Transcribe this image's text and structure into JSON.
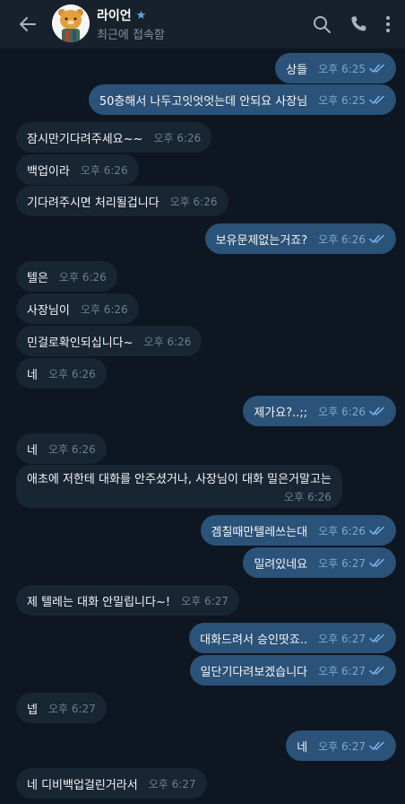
{
  "header": {
    "title": "라이언",
    "status": "최근에 접속함",
    "accent": "#5ea8f0",
    "icons": [
      "back-arrow-icon",
      "verified-star-icon",
      "search-icon",
      "phone-icon",
      "more-vertical-icon"
    ]
  },
  "messages": [
    {
      "dir": "out",
      "text": "상들",
      "time": "오후 6:25"
    },
    {
      "dir": "out",
      "text": "50층해서 나두고잇엇엇는데 안되요 사장님",
      "time": "오후 6:25"
    },
    {
      "dir": "in",
      "text": "잠시만기다려주세요~~",
      "time": "오후 6:26"
    },
    {
      "dir": "in",
      "text": "백업이라",
      "time": "오후 6:26"
    },
    {
      "dir": "in",
      "text": "기다려주시면 처리될겁니다",
      "time": "오후 6:26"
    },
    {
      "dir": "out",
      "text": "보유문제없는거죠?",
      "time": "오후 6:26"
    },
    {
      "dir": "in",
      "text": "텔은",
      "time": "오후 6:26"
    },
    {
      "dir": "in",
      "text": "사장님이",
      "time": "오후 6:26"
    },
    {
      "dir": "in",
      "text": "민걸로확인되십니다~",
      "time": "오후 6:26"
    },
    {
      "dir": "in",
      "text": "네",
      "time": "오후 6:26"
    },
    {
      "dir": "out",
      "text": "제가요?..;;",
      "time": "오후 6:26"
    },
    {
      "dir": "in",
      "text": "네",
      "time": "오후 6:26"
    },
    {
      "dir": "in",
      "text": "애초에 저한테 대화를 안주셨거나, 사장님이 대화 밀은거말고는",
      "time": "오후 6:26"
    },
    {
      "dir": "out",
      "text": "겜칠때만텔레쓰는대",
      "time": "오후 6:26"
    },
    {
      "dir": "out",
      "text": "밀려있네요",
      "time": "오후 6:27"
    },
    {
      "dir": "in",
      "text": "제 텔레는 대화 안밀립니다~!",
      "time": "오후 6:27"
    },
    {
      "dir": "out",
      "text": "대화드려서 승인땃죠..",
      "time": "오후 6:27"
    },
    {
      "dir": "out",
      "text": "일단기다려보겠습니다",
      "time": "오후 6:27"
    },
    {
      "dir": "in",
      "text": "넵",
      "time": "오후 6:27"
    },
    {
      "dir": "out",
      "text": "네",
      "time": "오후 6:27"
    },
    {
      "dir": "in",
      "text": "네 디비백업걸린거라서",
      "time": "오후 6:27"
    }
  ]
}
